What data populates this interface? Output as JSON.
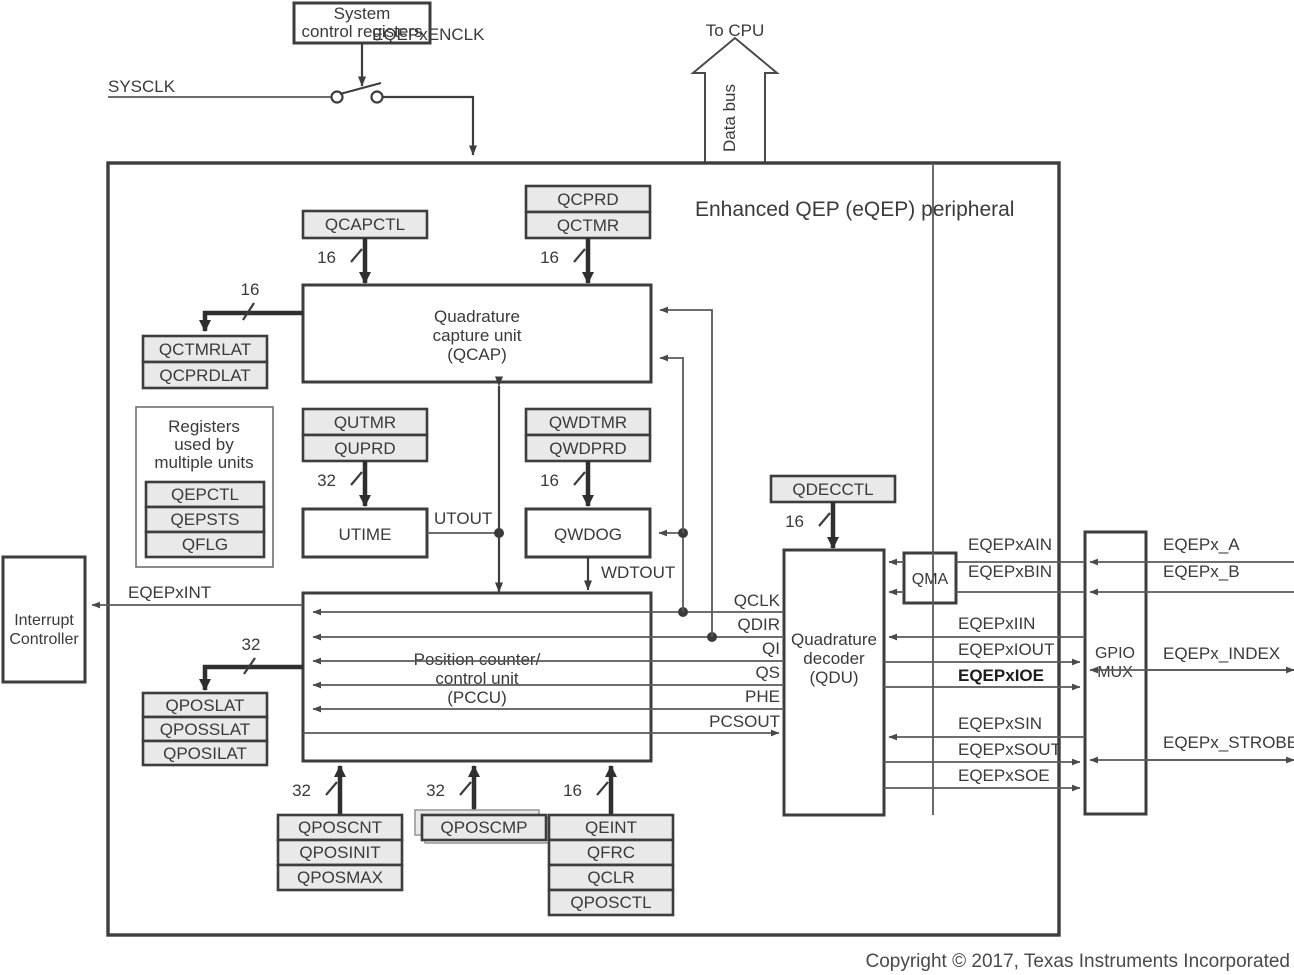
{
  "diagram": {
    "title": "Enhanced QEP (eQEP) peripheral",
    "copyright": "Copyright © 2017, Texas Instruments Incorporated"
  },
  "top": {
    "system_control_registers": "System\ncontrol registers",
    "system_control_line1": "System",
    "system_control_line2": "control registers",
    "enclk_label": "EQEPxENCLK",
    "sysclk_label": "SYSCLK",
    "to_cpu_label": "To CPU",
    "data_bus_label": "Data bus"
  },
  "units": {
    "qcap_line1": "Quadrature",
    "qcap_line2": "capture unit",
    "qcap_line3": "(QCAP)",
    "pccu_line1": "Position counter/",
    "pccu_line2": "control unit",
    "pccu_line3": "(PCCU)",
    "qdu_line1": "Quadrature",
    "qdu_line2": "decoder",
    "qdu_line3": "(QDU)",
    "utime": "UTIME",
    "qwdog": "QWDOG",
    "qma": "QMA",
    "gpio_mux_line1": "GPIO",
    "gpio_mux_line2": "MUX",
    "interrupt_line1": "Interrupt",
    "interrupt_line2": "Controller"
  },
  "register_groups": {
    "qcapctl": [
      "QCAPCTL"
    ],
    "qcprd_qctmr": [
      "QCPRD",
      "QCTMR"
    ],
    "qctmrlat_qcprdlat": [
      "QCTMRLAT",
      "QCPRDLAT"
    ],
    "qutmr_quprd": [
      "QUTMR",
      "QUPRD"
    ],
    "qwdtmr_qwdprd": [
      "QWDTMR",
      "QWDPRD"
    ],
    "qdecctl": [
      "QDECCTL"
    ],
    "shared_title_line1": "Registers",
    "shared_title_line2": "used by",
    "shared_title_line3": "multiple units",
    "shared": [
      "QEPCTL",
      "QEPSTS",
      "QFLG"
    ],
    "qposlat_group": [
      "QPOSLAT",
      "QPOSSLAT",
      "QPOSILAT"
    ],
    "qposcnt_group": [
      "QPOSCNT",
      "QPOSINIT",
      "QPOSMAX"
    ],
    "qposcmp_group": [
      "QPOSCMP"
    ],
    "qeint_group": [
      "QEINT",
      "QFRC",
      "QCLR",
      "QPOSCTL"
    ]
  },
  "bus_widths": {
    "qcapctl": "16",
    "qctmr": "16",
    "qcap_out": "16",
    "quprd": "32",
    "qwdprd": "16",
    "qdecctl": "16",
    "qposlat": "32",
    "qposcnt": "32",
    "qposcmp": "32",
    "qeint": "16"
  },
  "signals": {
    "utout": "UTOUT",
    "wdtout": "WDTOUT",
    "eqepxint": "EQEPxINT",
    "internal": [
      "QCLK",
      "QDIR",
      "QI",
      "QS",
      "PHE",
      "PCSOUT"
    ],
    "decoder_io": [
      "EQEPxAIN",
      "EQEPxBIN",
      "EQEPxIIN",
      "EQEPxIOUT",
      "EQEPxIOE",
      "EQEPxSIN",
      "EQEPxSOUT",
      "EQEPxSOE"
    ],
    "external": [
      "EQEPx_A",
      "EQEPx_B",
      "EQEPx_INDEX",
      "EQEPx_STROBE"
    ]
  },
  "colors": {
    "register_fill": "#e9e9e9",
    "stroke_dark": "#3d3d3d",
    "wire": "#5a5a5a",
    "text": "#3a3a3a"
  }
}
